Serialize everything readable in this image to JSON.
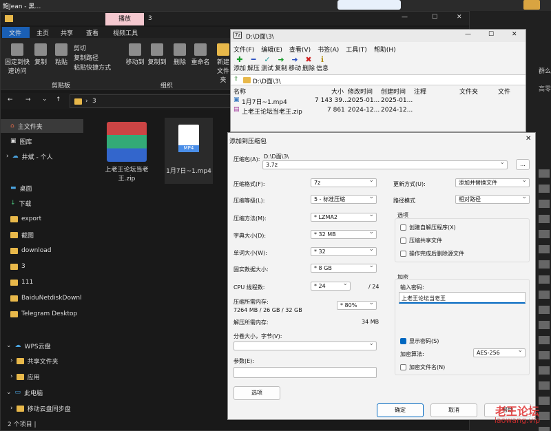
{
  "workspace": {
    "title": "鲍Jean - 黑…"
  },
  "explorer": {
    "tab_manage": "播放",
    "tab_folder": "3",
    "ribbon_tabs": [
      "文件",
      "主页",
      "共享",
      "查看",
      "视频工具"
    ],
    "clipboard_group": "剪贴板",
    "organize_group": "组织",
    "buttons": {
      "pin": "固定到快速访问",
      "copy": "复制",
      "paste": "粘贴",
      "cut": "剪切",
      "copy_path": "复制路径",
      "paste_shortcut": "粘贴快捷方式",
      "move_to": "移动到",
      "copy_to": "复制到",
      "delete": "删除",
      "rename": "重命名",
      "new": "新建文件夹"
    },
    "breadcrumb": "3",
    "sidebar": [
      "主文件夹",
      "图库",
      "井斌 - 个人",
      "桌面",
      "下载",
      "export",
      "截图",
      "download",
      "3",
      "111",
      "BaiduNetdiskDownl",
      "Telegram Desktop",
      "WPS云盘",
      "共享文件夹",
      "应用",
      "此电脑",
      "移动云盘同步盘"
    ],
    "files": [
      {
        "name": "上老王论坛当老王.zip"
      },
      {
        "name": "1月7日~1.mp4"
      }
    ],
    "mp4_badge": "MP4",
    "status": "2 个项目 |"
  },
  "sevenzip": {
    "title": "D:\\D面\\3\\",
    "menu": [
      "文件(F)",
      "编辑(E)",
      "查看(V)",
      "书签(A)",
      "工具(T)",
      "帮助(H)"
    ],
    "toolbar": [
      "添加",
      "解压",
      "测试",
      "复制",
      "移动",
      "删除",
      "信息"
    ],
    "path": "D:\\D面\\3\\",
    "columns": [
      "名称",
      "大小",
      "修改时间",
      "创建时间",
      "注释",
      "文件夹",
      "文件"
    ],
    "rows": [
      {
        "name": "1月7日~1.mp4",
        "size": "7 143 39...",
        "mtime": "2025-01...",
        "ctime": "2025-01..."
      },
      {
        "name": "上老王论坛当老王.zip",
        "size": "7 861",
        "mtime": "2024-12...",
        "ctime": "2024-12..."
      }
    ]
  },
  "dialog": {
    "title": "添加到压缩包",
    "archive_label": "压缩包(A):",
    "archive_dir": "D:\\D面\\3\\",
    "archive_name": "3.7z",
    "browse": "...",
    "format_label": "压缩格式(F):",
    "format": "7z",
    "level_label": "压缩等级(L):",
    "level": "5 - 标准压缩",
    "method_label": "压缩方法(M):",
    "method": "* LZMA2",
    "dict_label": "字典大小(D):",
    "dict": "* 32 MB",
    "word_label": "单词大小(W):",
    "word": "* 32",
    "solid_label": "固实数据大小:",
    "solid": "* 8 GB",
    "cpu_label": "CPU 线程数:",
    "cpu": "* 24",
    "cpu_total": "/ 24",
    "mem_comp_label": "压缩所需内存:",
    "mem_comp_detail": "7264 MB / 26 GB / 32 GB",
    "mem_pct": "* 80%",
    "mem_decomp_label": "解压所需内存:",
    "mem_decomp": "34 MB",
    "split_label": "分卷大小，字节(V):",
    "params_label": "参数(E):",
    "options_button": "选项",
    "update_label": "更新方式(U):",
    "update": "添加并替换文件",
    "pathmode_label": "路径模式",
    "pathmode": "相对路径",
    "options_group": "选项",
    "opt_sfx": "创建自解压程序(X)",
    "opt_shared": "压缩共享文件",
    "opt_delete": "操作完成后删除源文件",
    "encrypt_group": "加密",
    "pwd_label": "输入密码:",
    "pwd_value": "上老王论坛当老王",
    "show_pwd": "显示密码(S)",
    "enc_method_label": "加密算法:",
    "enc_method": "AES-256",
    "enc_names": "加密文件名(N)",
    "ok": "确定",
    "cancel": "取消",
    "help": "帮助"
  },
  "watermark": {
    "line1": "老王论坛",
    "line2": "laowang.vip"
  },
  "right_panel": {
    "t1": "群么",
    "t2": "高零"
  }
}
